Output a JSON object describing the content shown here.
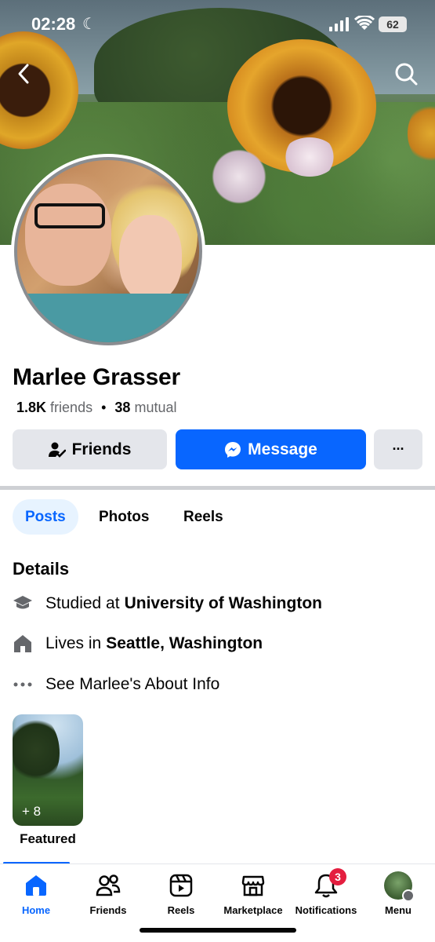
{
  "status_bar": {
    "time": "02:28",
    "battery": "62"
  },
  "profile": {
    "name": "Marlee Grasser",
    "friends_count": "1.8K",
    "friends_label": "friends",
    "separator": "•",
    "mutual_count": "38",
    "mutual_label": "mutual"
  },
  "actions": {
    "friends_label": "Friends",
    "message_label": "Message",
    "more_label": "···"
  },
  "tabs": [
    {
      "label": "Posts",
      "active": true
    },
    {
      "label": "Photos",
      "active": false
    },
    {
      "label": "Reels",
      "active": false
    }
  ],
  "details": {
    "title": "Details",
    "items": [
      {
        "icon": "graduation-cap-icon",
        "prefix": "Studied at",
        "bold": "University of Washington"
      },
      {
        "icon": "home-icon",
        "prefix": "Lives in",
        "bold": "Seattle, Washington"
      },
      {
        "icon": "more-dots-icon",
        "prefix": "See Marlee's About Info",
        "bold": ""
      }
    ]
  },
  "featured": {
    "count": "+ 8",
    "label": "Featured"
  },
  "bottom_nav": {
    "items": [
      {
        "label": "Home",
        "icon": "home-icon",
        "active": true
      },
      {
        "label": "Friends",
        "icon": "friends-icon"
      },
      {
        "label": "Reels",
        "icon": "reels-icon"
      },
      {
        "label": "Marketplace",
        "icon": "marketplace-icon"
      },
      {
        "label": "Notifications",
        "icon": "bell-icon",
        "badge": "3"
      },
      {
        "label": "Menu",
        "icon": "menu-avatar-icon"
      }
    ]
  },
  "colors": {
    "accent": "#0866ff",
    "badge": "#e41e3f",
    "secondary_button": "#e4e6eb"
  }
}
